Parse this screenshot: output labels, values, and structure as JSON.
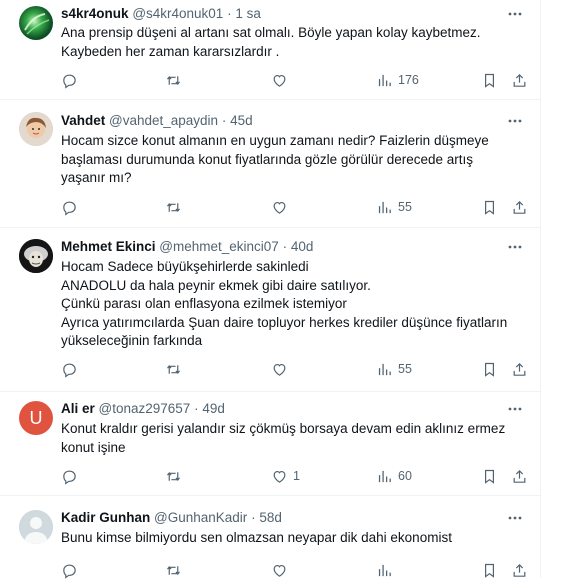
{
  "tweets": [
    {
      "name": "s4kr4onuk",
      "handle": "@s4kr4onuk01",
      "time": "1 sa",
      "text": "Ana prensip düşeni al artanı sat olmalı. Böyle yapan kolay kaybetmez.\nKaybeden her zaman kararsızlardır .",
      "likes": "",
      "views": "176",
      "avatar": "green-swirl"
    },
    {
      "name": "Vahdet",
      "handle": "@vahdet_apaydin",
      "time": "45d",
      "text": "Hocam sizce konut almanın en uygun zamanı nedir? Faizlerin düşmeye\nbaşlaması durumunda konut fiyatlarında gözle görülür derecede artış\nyaşanır mı?",
      "likes": "",
      "views": "55",
      "avatar": "child-photo"
    },
    {
      "name": "Mehmet Ekinci",
      "handle": "@mehmet_ekinci07",
      "time": "40d",
      "text": "Hocam Sadece büyükşehirlerde sakinledi\nANADOLU da hala peynir ekmek gibi daire satılıyor.\nÇünkü parası olan enflasyona ezilmek istemiyor\nAyrıca yatırımcılarda Şuan daire topluyor herkes krediler düşünce fiyatların\nyükseleceğinin farkında",
      "likes": "",
      "views": "55",
      "avatar": "dark-portrait"
    },
    {
      "name": "Ali er",
      "handle": "@tonaz297657",
      "time": "49d",
      "text": "Konut kraldır gerisi yalandır siz çökmüş borsaya devam edin aklınız ermez\nkonut işine",
      "likes": "1",
      "views": "60",
      "avatar": "letter-U",
      "initial": "U",
      "avatar_color": "#e0533f"
    },
    {
      "name": "Kadir Gunhan",
      "handle": "@GunhanKadir",
      "time": "58d",
      "text": "Bunu kimse bilmiyordu sen olmazsan neyapar dik dahi ekonomist",
      "likes": "",
      "views": "",
      "avatar": "default-person"
    }
  ],
  "colors": {
    "text": "#0f1419",
    "meta": "#536471",
    "border": "#eff3f4"
  },
  "icons": [
    "more-icon",
    "reply-icon",
    "retweet-icon",
    "like-icon",
    "views-icon",
    "bookmark-icon",
    "share-icon"
  ]
}
